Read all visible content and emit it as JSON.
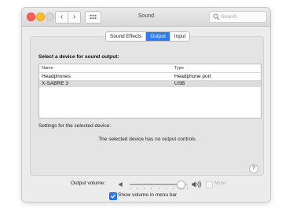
{
  "window": {
    "title": "Sound",
    "search_placeholder": "Search",
    "nav_back": "‹",
    "nav_forward": "›"
  },
  "tabs": [
    {
      "label": "Sound Effects",
      "active": false
    },
    {
      "label": "Output",
      "active": true
    },
    {
      "label": "Input",
      "active": false
    }
  ],
  "output": {
    "section_label": "Select a device for sound output:",
    "columns": {
      "name": "Name",
      "type": "Type"
    },
    "devices": [
      {
        "name": "Headphones",
        "type": "Headphone port",
        "selected": false
      },
      {
        "name": "X-SABRE 3",
        "type": "USB",
        "selected": true
      }
    ],
    "settings_label": "Settings for the selected device:",
    "no_controls_message": "The selected device has no output controls"
  },
  "help_label": "?",
  "volume": {
    "label": "Output volume:",
    "level": 0.88,
    "mute_label": "Mute",
    "mute_checked": false,
    "show_in_menubar_label": "Show volume in menu bar",
    "show_in_menubar_checked": true
  },
  "colors": {
    "accent": "#2d7cf6",
    "close": "#ff5f57",
    "minimize": "#febc2e",
    "zoom_disabled": "#d7d7d7"
  }
}
